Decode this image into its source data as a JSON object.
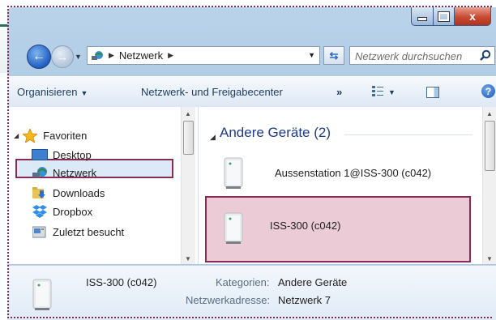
{
  "window": {
    "controls": {
      "minimize": "minimize",
      "maximize": "maximize",
      "close": "x"
    }
  },
  "navigation": {
    "breadcrumb": [
      "Netzwerk"
    ],
    "search_placeholder": "Netzwerk durchsuchen"
  },
  "toolbar": {
    "organize_label": "Organisieren",
    "network_center_label": "Netzwerk- und Freigabecenter",
    "more_label": "»",
    "help_label": "?"
  },
  "sidebar": {
    "items": [
      {
        "label": "Favoriten",
        "icon": "star-icon",
        "selected": false
      },
      {
        "label": "Desktop",
        "icon": "desktop-icon",
        "selected": false
      },
      {
        "label": "Netzwerk",
        "icon": "network-icon",
        "selected": true
      },
      {
        "label": "Downloads",
        "icon": "downloads-folder-icon",
        "selected": false
      },
      {
        "label": "Dropbox",
        "icon": "dropbox-icon",
        "selected": false
      },
      {
        "label": "Zuletzt besucht",
        "icon": "recent-places-icon",
        "selected": false
      }
    ]
  },
  "content": {
    "group_title": "Andere Geräte (2)",
    "items": [
      {
        "label": "Aussenstation 1@ISS-300 (c042)",
        "icon": "device-icon",
        "selected": false
      },
      {
        "label": "ISS-300 (c042)",
        "icon": "device-icon",
        "selected": true
      }
    ]
  },
  "details": {
    "name": "ISS-300 (c042)",
    "category_label": "Kategorien:",
    "category_value": "Andere Geräte",
    "address_label": "Netzwerkadresse:",
    "address_value": "Netzwerk 7"
  },
  "colors": {
    "highlight_border": "#8a2b55",
    "selected_fill": "#eacbd6",
    "group_header": "#1e3a8a"
  }
}
